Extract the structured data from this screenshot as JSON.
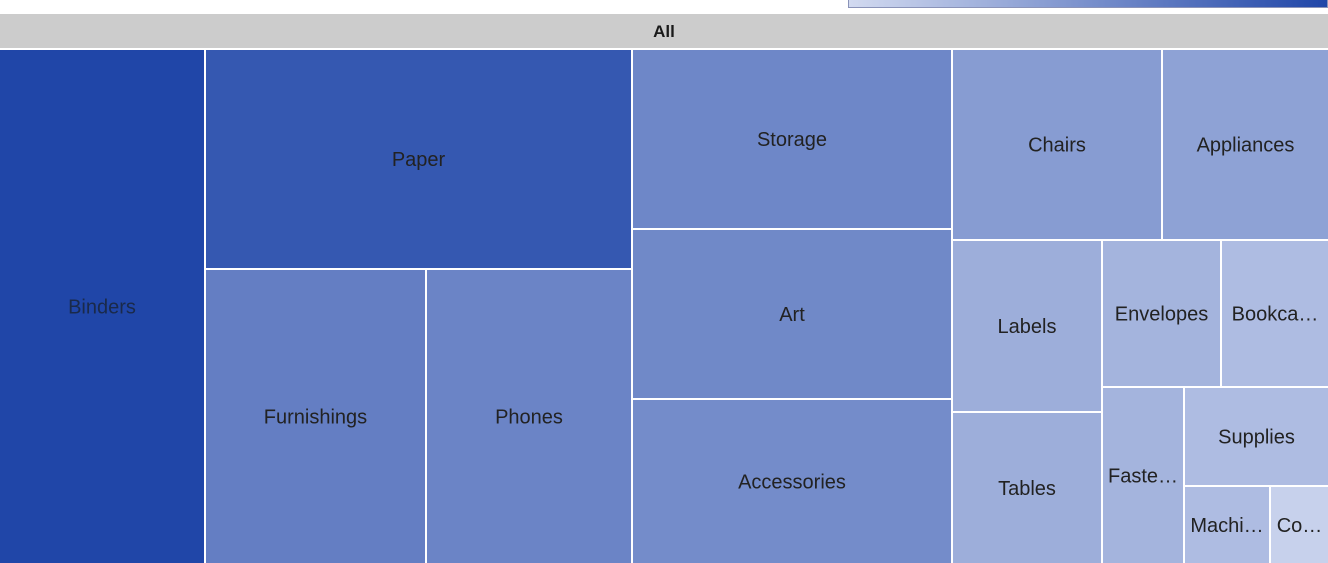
{
  "chart_data": {
    "type": "treemap",
    "root": "All",
    "colors": {
      "min": "#d2daf0",
      "max": "#2046a8",
      "root": "#cccccc",
      "border": "#ffffff"
    },
    "items": [
      {
        "name": "Binders",
        "value": 1.0
      },
      {
        "name": "Paper",
        "value": 0.88
      },
      {
        "name": "Furnishings",
        "value": 0.62
      },
      {
        "name": "Phones",
        "value": 0.58
      },
      {
        "name": "Storage",
        "value": 0.56
      },
      {
        "name": "Art",
        "value": 0.55
      },
      {
        "name": "Accessories",
        "value": 0.53
      },
      {
        "name": "Chairs",
        "value": 0.42
      },
      {
        "name": "Appliances",
        "value": 0.38
      },
      {
        "name": "Labels",
        "value": 0.3
      },
      {
        "name": "Tables",
        "value": 0.3
      },
      {
        "name": "Envelopes",
        "value": 0.26
      },
      {
        "name": "Bookca…",
        "value": 0.2
      },
      {
        "name": "Faste…",
        "value": 0.26
      },
      {
        "name": "Supplies",
        "value": 0.2
      },
      {
        "name": "Machi…",
        "value": 0.2
      },
      {
        "name": "Co…",
        "value": 0.06
      }
    ]
  }
}
